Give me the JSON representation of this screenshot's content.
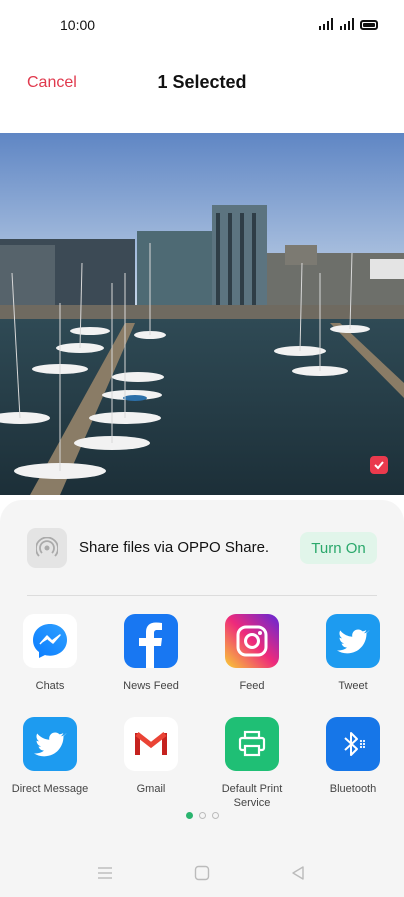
{
  "status": {
    "time": "10:00",
    "signal_icon": "signal-icon",
    "battery_icon": "battery-icon"
  },
  "header": {
    "cancel_label": "Cancel",
    "title": "1 Selected"
  },
  "photo": {
    "description_icon": "harbor-photo",
    "selected": true
  },
  "share": {
    "text": "Share files via OPPO Share.",
    "button_label": "Turn On",
    "icon": "oppo-share-icon"
  },
  "apps": [
    {
      "label": "Chats",
      "icon": "messenger-icon"
    },
    {
      "label": "News Feed",
      "icon": "facebook-icon"
    },
    {
      "label": "Feed",
      "icon": "instagram-icon"
    },
    {
      "label": "Tweet",
      "icon": "twitter-icon"
    },
    {
      "label": "Direct Message",
      "icon": "twitter-icon"
    },
    {
      "label": "Gmail",
      "icon": "gmail-icon"
    },
    {
      "label": "Default Print Service",
      "icon": "print-icon"
    },
    {
      "label": "Bluetooth",
      "icon": "bluetooth-icon"
    }
  ],
  "pager": {
    "pages": 3,
    "current": 1
  },
  "colors": {
    "accent_red": "#e0394d",
    "share_green": "#2aa86b",
    "pager_active": "#2ab46f"
  },
  "nav": {
    "menu_icon": "menu-icon",
    "home_icon": "home-icon",
    "back_icon": "back-icon"
  }
}
